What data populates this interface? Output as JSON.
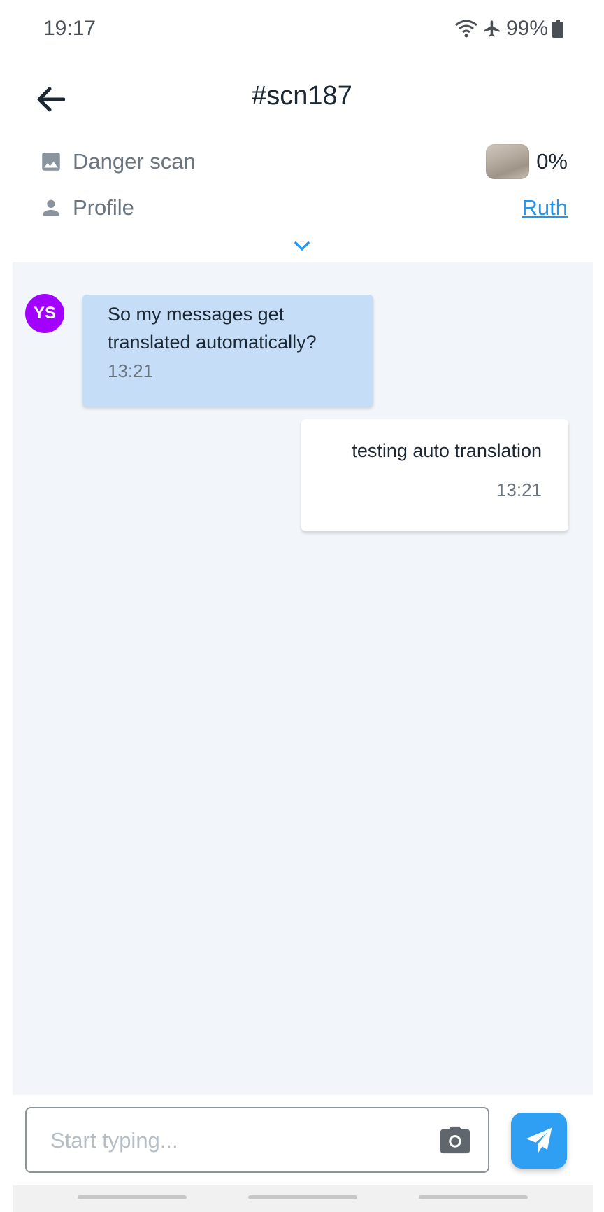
{
  "status_bar": {
    "time": "19:17",
    "battery": "99%"
  },
  "header": {
    "title": "#scn187"
  },
  "info": {
    "danger_scan": {
      "label": "Danger scan",
      "value": "0%"
    },
    "profile": {
      "label": "Profile",
      "value": "Ruth"
    }
  },
  "messages": [
    {
      "direction": "incoming",
      "avatar_initials": "YS",
      "avatar_color": "#a200ff",
      "text": "So my messages get translated automatically?",
      "time": "13:21"
    },
    {
      "direction": "outgoing",
      "text": "testing auto translation",
      "time": "13:21"
    }
  ],
  "composer": {
    "placeholder": "Start typing...",
    "value": ""
  },
  "colors": {
    "accent": "#2196f3",
    "incoming_bubble": "#c5ddf7",
    "chat_background": "#f2f6fa"
  }
}
